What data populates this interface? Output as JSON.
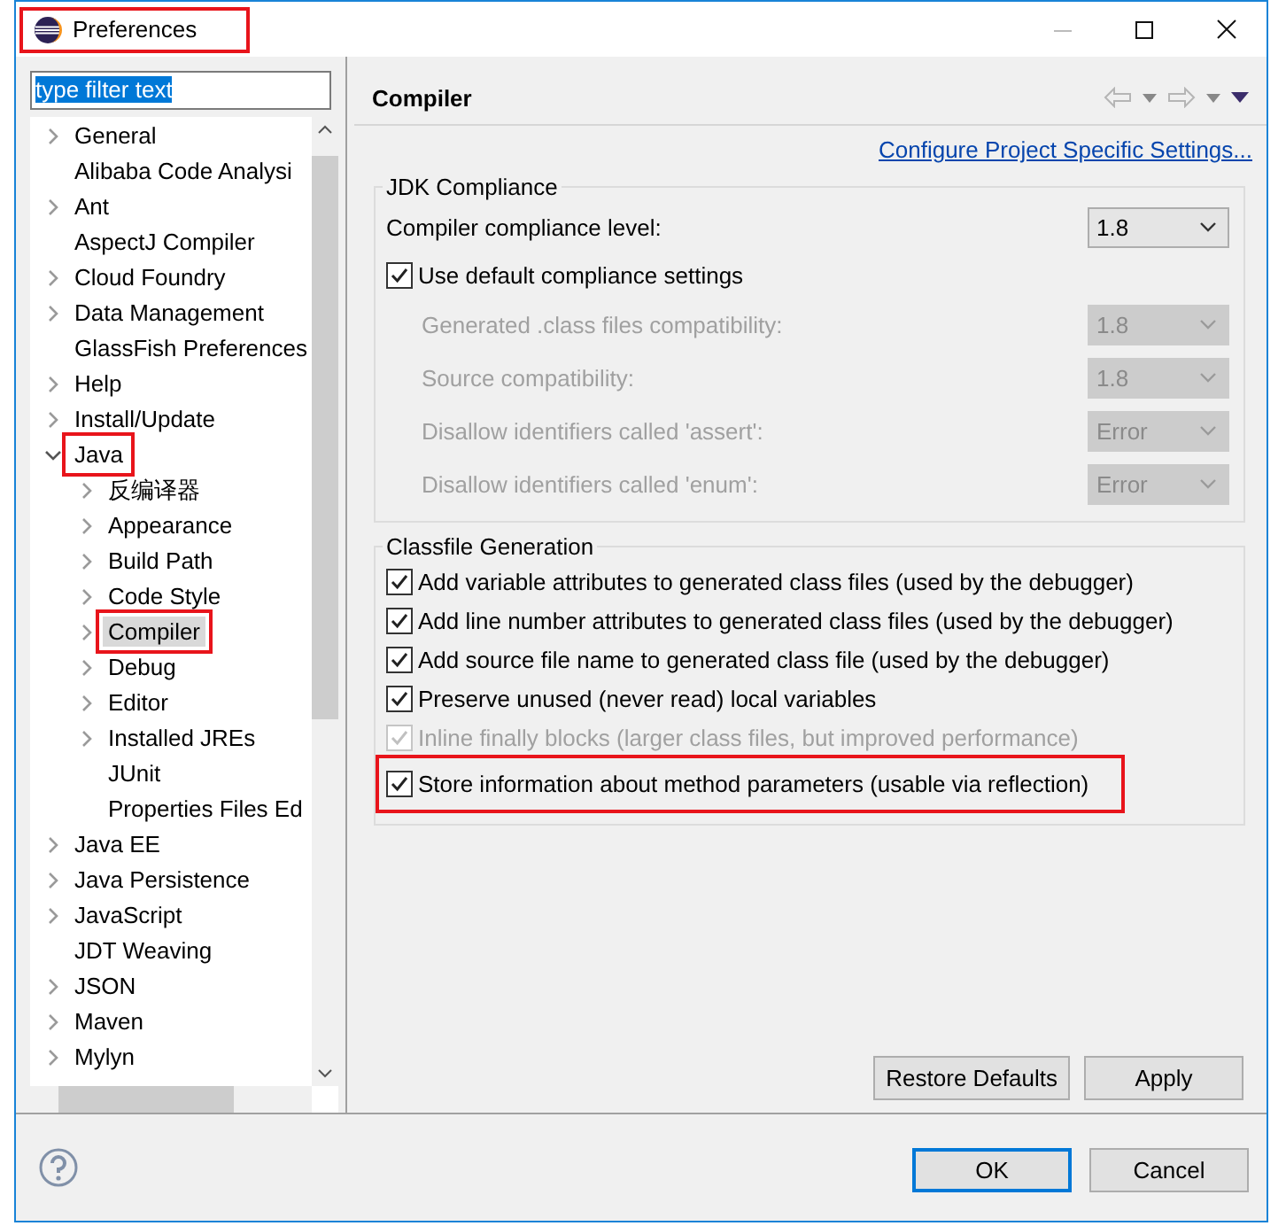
{
  "window": {
    "title": "Preferences",
    "highlighted": true
  },
  "filter": {
    "value": "type filter text",
    "text_selected": true
  },
  "tree": [
    {
      "label": "General",
      "kind": "branch",
      "expanded": false,
      "selected": false,
      "highlighted": false
    },
    {
      "label": "Alibaba Code Analysi",
      "kind": "leaf",
      "selected": false,
      "highlighted": false
    },
    {
      "label": "Ant",
      "kind": "branch",
      "expanded": false,
      "selected": false,
      "highlighted": false
    },
    {
      "label": "AspectJ Compiler",
      "kind": "leaf",
      "selected": false,
      "highlighted": false
    },
    {
      "label": "Cloud Foundry",
      "kind": "branch",
      "expanded": false,
      "selected": false,
      "highlighted": false
    },
    {
      "label": "Data Management",
      "kind": "branch",
      "expanded": false,
      "selected": false,
      "highlighted": false
    },
    {
      "label": "GlassFish Preferences",
      "kind": "leaf",
      "selected": false,
      "highlighted": false
    },
    {
      "label": "Help",
      "kind": "branch",
      "expanded": false,
      "selected": false,
      "highlighted": false
    },
    {
      "label": "Install/Update",
      "kind": "branch",
      "expanded": false,
      "selected": false,
      "highlighted": false
    },
    {
      "label": "Java",
      "kind": "branch",
      "expanded": true,
      "selected": false,
      "highlighted": true,
      "children": [
        {
          "label": "反编译器",
          "kind": "branch",
          "expanded": false,
          "selected": false,
          "highlighted": false
        },
        {
          "label": "Appearance",
          "kind": "branch",
          "expanded": false,
          "selected": false,
          "highlighted": false
        },
        {
          "label": "Build Path",
          "kind": "branch",
          "expanded": false,
          "selected": false,
          "highlighted": false
        },
        {
          "label": "Code Style",
          "kind": "branch",
          "expanded": false,
          "selected": false,
          "highlighted": false
        },
        {
          "label": "Compiler",
          "kind": "branch",
          "expanded": false,
          "selected": true,
          "highlighted": true
        },
        {
          "label": "Debug",
          "kind": "branch",
          "expanded": false,
          "selected": false,
          "highlighted": false
        },
        {
          "label": "Editor",
          "kind": "branch",
          "expanded": false,
          "selected": false,
          "highlighted": false
        },
        {
          "label": "Installed JREs",
          "kind": "branch",
          "expanded": false,
          "selected": false,
          "highlighted": false
        },
        {
          "label": "JUnit",
          "kind": "leaf",
          "selected": false,
          "highlighted": false
        },
        {
          "label": "Properties Files Ed",
          "kind": "leaf",
          "selected": false,
          "highlighted": false
        }
      ]
    },
    {
      "label": "Java EE",
      "kind": "branch",
      "expanded": false,
      "selected": false,
      "highlighted": false
    },
    {
      "label": "Java Persistence",
      "kind": "branch",
      "expanded": false,
      "selected": false,
      "highlighted": false
    },
    {
      "label": "JavaScript",
      "kind": "branch",
      "expanded": false,
      "selected": false,
      "highlighted": false
    },
    {
      "label": "JDT Weaving",
      "kind": "leaf",
      "selected": false,
      "highlighted": false
    },
    {
      "label": "JSON",
      "kind": "branch",
      "expanded": false,
      "selected": false,
      "highlighted": false
    },
    {
      "label": "Maven",
      "kind": "branch",
      "expanded": false,
      "selected": false,
      "highlighted": false
    },
    {
      "label": "Mylyn",
      "kind": "branch",
      "expanded": false,
      "selected": false,
      "highlighted": false
    }
  ],
  "page": {
    "title": "Compiler",
    "link": "Configure Project Specific Settings...",
    "jdk_compliance": {
      "title": "JDK Compliance",
      "compliance_level": {
        "label": "Compiler compliance level:",
        "value": "1.8",
        "disabled": false
      },
      "use_default": {
        "label": "Use default compliance settings",
        "checked": true
      },
      "settings": [
        {
          "label": "Generated .class files compatibility:",
          "value": "1.8",
          "disabled": true
        },
        {
          "label": "Source compatibility:",
          "value": "1.8",
          "disabled": true
        },
        {
          "label": "Disallow identifiers called 'assert':",
          "value": "Error",
          "disabled": true
        },
        {
          "label": "Disallow identifiers called 'enum':",
          "value": "Error",
          "disabled": true
        }
      ]
    },
    "classfile_generation": {
      "title": "Classfile Generation",
      "options": [
        {
          "label": "Add variable attributes to generated class files (used by the debugger)",
          "checked": true,
          "disabled": false,
          "highlighted": false
        },
        {
          "label": "Add line number attributes to generated class files (used by the debugger)",
          "checked": true,
          "disabled": false,
          "highlighted": false
        },
        {
          "label": "Add source file name to generated class file (used by the debugger)",
          "checked": true,
          "disabled": false,
          "highlighted": false
        },
        {
          "label": "Preserve unused (never read) local variables",
          "checked": true,
          "disabled": false,
          "highlighted": false
        },
        {
          "label": "Inline finally blocks (larger class files, but improved performance)",
          "checked": true,
          "disabled": true,
          "highlighted": false
        },
        {
          "label": "Store information about method parameters (usable via reflection)",
          "checked": true,
          "disabled": false,
          "highlighted": true
        }
      ]
    },
    "buttons": [
      "Restore Defaults",
      "Apply"
    ]
  },
  "footer": {
    "buttons": [
      {
        "label": "OK",
        "default": true
      },
      {
        "label": "Cancel",
        "default": false
      }
    ]
  }
}
